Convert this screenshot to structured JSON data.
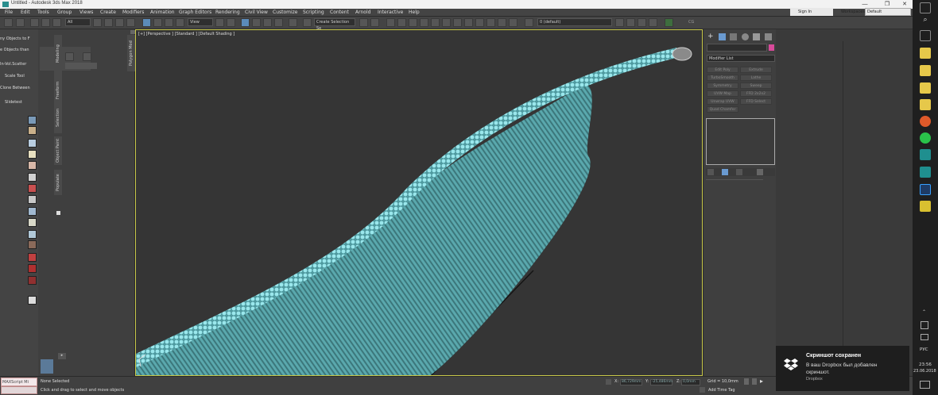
{
  "window": {
    "title": "Untitled - Autodesk 3ds Max 2018"
  },
  "menu": [
    "File",
    "Edit",
    "Tools",
    "Group",
    "Views",
    "Create",
    "Modifiers",
    "Animation",
    "Graph Editors",
    "Rendering",
    "Civil View",
    "Customize",
    "Scripting",
    "Content",
    "Arnold",
    "Interactive",
    "Help"
  ],
  "account": {
    "sign_in": "Sign In",
    "workspaces_label": "Workspaces:",
    "workspace_value": "Default"
  },
  "toolbar": {
    "filter": "All",
    "view": "View",
    "selection_set": "Create Selection Se",
    "layer": "0 (default)",
    "cg": "CG"
  },
  "left_panel": [
    "ny Objects to F",
    "e Objects than",
    "In-Vol.Scatter",
    "Scale Tool",
    "Clone Between",
    "Slidetest"
  ],
  "ribbon_tabs": [
    "Modeling",
    "Freeform",
    "Selection",
    "Object Paint",
    "Populate"
  ],
  "ribbon_title": "Polygon Mod",
  "viewport": {
    "label": "[+] [Perspective ] [Standard ] [Default Shading ]"
  },
  "modifier": {
    "list_label": "Modifier List",
    "buttons": [
      [
        "Edit Poly",
        "Extrude"
      ],
      [
        "TurboSmooth",
        "Lathe"
      ],
      [
        "Symmetry",
        "Sweep"
      ],
      [
        "UVW Map",
        "FFD 2x2x2"
      ],
      [
        "Unwrap UVW",
        "FFD Select"
      ],
      [
        "Quad Chamfer",
        ""
      ]
    ]
  },
  "status": {
    "maxscript": "MAXScript Mi",
    "selected": "None Selected",
    "prompt": "Click and drag to select and move objects",
    "x_label": "X:",
    "x_value": "86,729mm",
    "y_label": "Y:",
    "y_value": "-25,486mm",
    "z_label": "Z:",
    "z_value": "0,0mm",
    "grid": "Grid = 10,0mm",
    "add_time_tag": "Add Time Tag"
  },
  "toast": {
    "title": "Скриншот сохранен",
    "body": "В ваш Dropbox был добавлен скриншот.",
    "source": "Dropbox"
  },
  "tray": {
    "lang": "РУС",
    "time": "23:56",
    "date": "23.06.2018"
  },
  "colors": {
    "object": "#6fd3d8",
    "accent": "#5b8bb9",
    "viewport_border": "#c8c84a",
    "swatch": "#d84a9a"
  }
}
